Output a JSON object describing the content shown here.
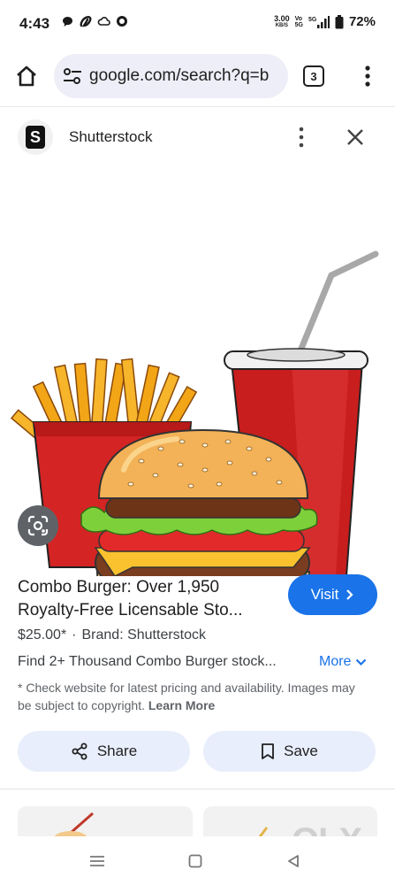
{
  "status_bar": {
    "time": "4:43",
    "net_speed": "3.00",
    "net_unit": "KB/S",
    "volte_top": "Vo",
    "volte_bottom": "5G",
    "signal_label": "5G",
    "battery": "72%"
  },
  "browser": {
    "url": "google.com/search?q=b",
    "tab_count": "3"
  },
  "source": {
    "name": "Shutterstock",
    "logo_letter": "S"
  },
  "result": {
    "title": "Combo Burger: Over 1,950 Royalty-Free Licensable Sto...",
    "visit_label": "Visit",
    "price": "$25.00*",
    "brand": "Brand: Shutterstock",
    "description": "Find 2+ Thousand Combo Burger stock...",
    "more_label": "More",
    "disclaimer": "* Check website for latest pricing and availability. Images may be subject to copyright.",
    "learn_more": "Learn More"
  },
  "actions": {
    "share_label": "Share",
    "save_label": "Save"
  },
  "watermark": "OLX",
  "colors": {
    "accent": "#1a73e8",
    "url_bar": "#edeef7",
    "action_bg": "#e8eefb"
  }
}
